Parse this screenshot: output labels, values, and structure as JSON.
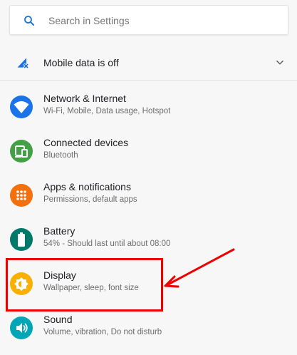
{
  "search": {
    "placeholder": "Search in Settings"
  },
  "condition": {
    "label": "Mobile data is off",
    "icon": "mobile-data-off-icon",
    "expand_icon": "chevron-down-icon"
  },
  "items": [
    {
      "title": "Network & Internet",
      "subtitle": "Wi-Fi, Mobile, Data usage, Hotspot",
      "icon": "wifi-icon",
      "color": "#1a73e8"
    },
    {
      "title": "Connected devices",
      "subtitle": "Bluetooth",
      "icon": "devices-icon",
      "color": "#43a047"
    },
    {
      "title": "Apps & notifications",
      "subtitle": "Permissions, default apps",
      "icon": "apps-grid-icon",
      "color": "#f4700c"
    },
    {
      "title": "Battery",
      "subtitle": "54% - Should last until about 08:00",
      "icon": "battery-icon",
      "color": "#00796b"
    },
    {
      "title": "Display",
      "subtitle": "Wallpaper, sleep, font size",
      "icon": "brightness-icon",
      "color": "#f9b000"
    },
    {
      "title": "Sound",
      "subtitle": "Volume, vibration, Do not disturb",
      "icon": "volume-icon",
      "color": "#00a6b5"
    }
  ],
  "annotation": {
    "color": "#ee0000"
  }
}
